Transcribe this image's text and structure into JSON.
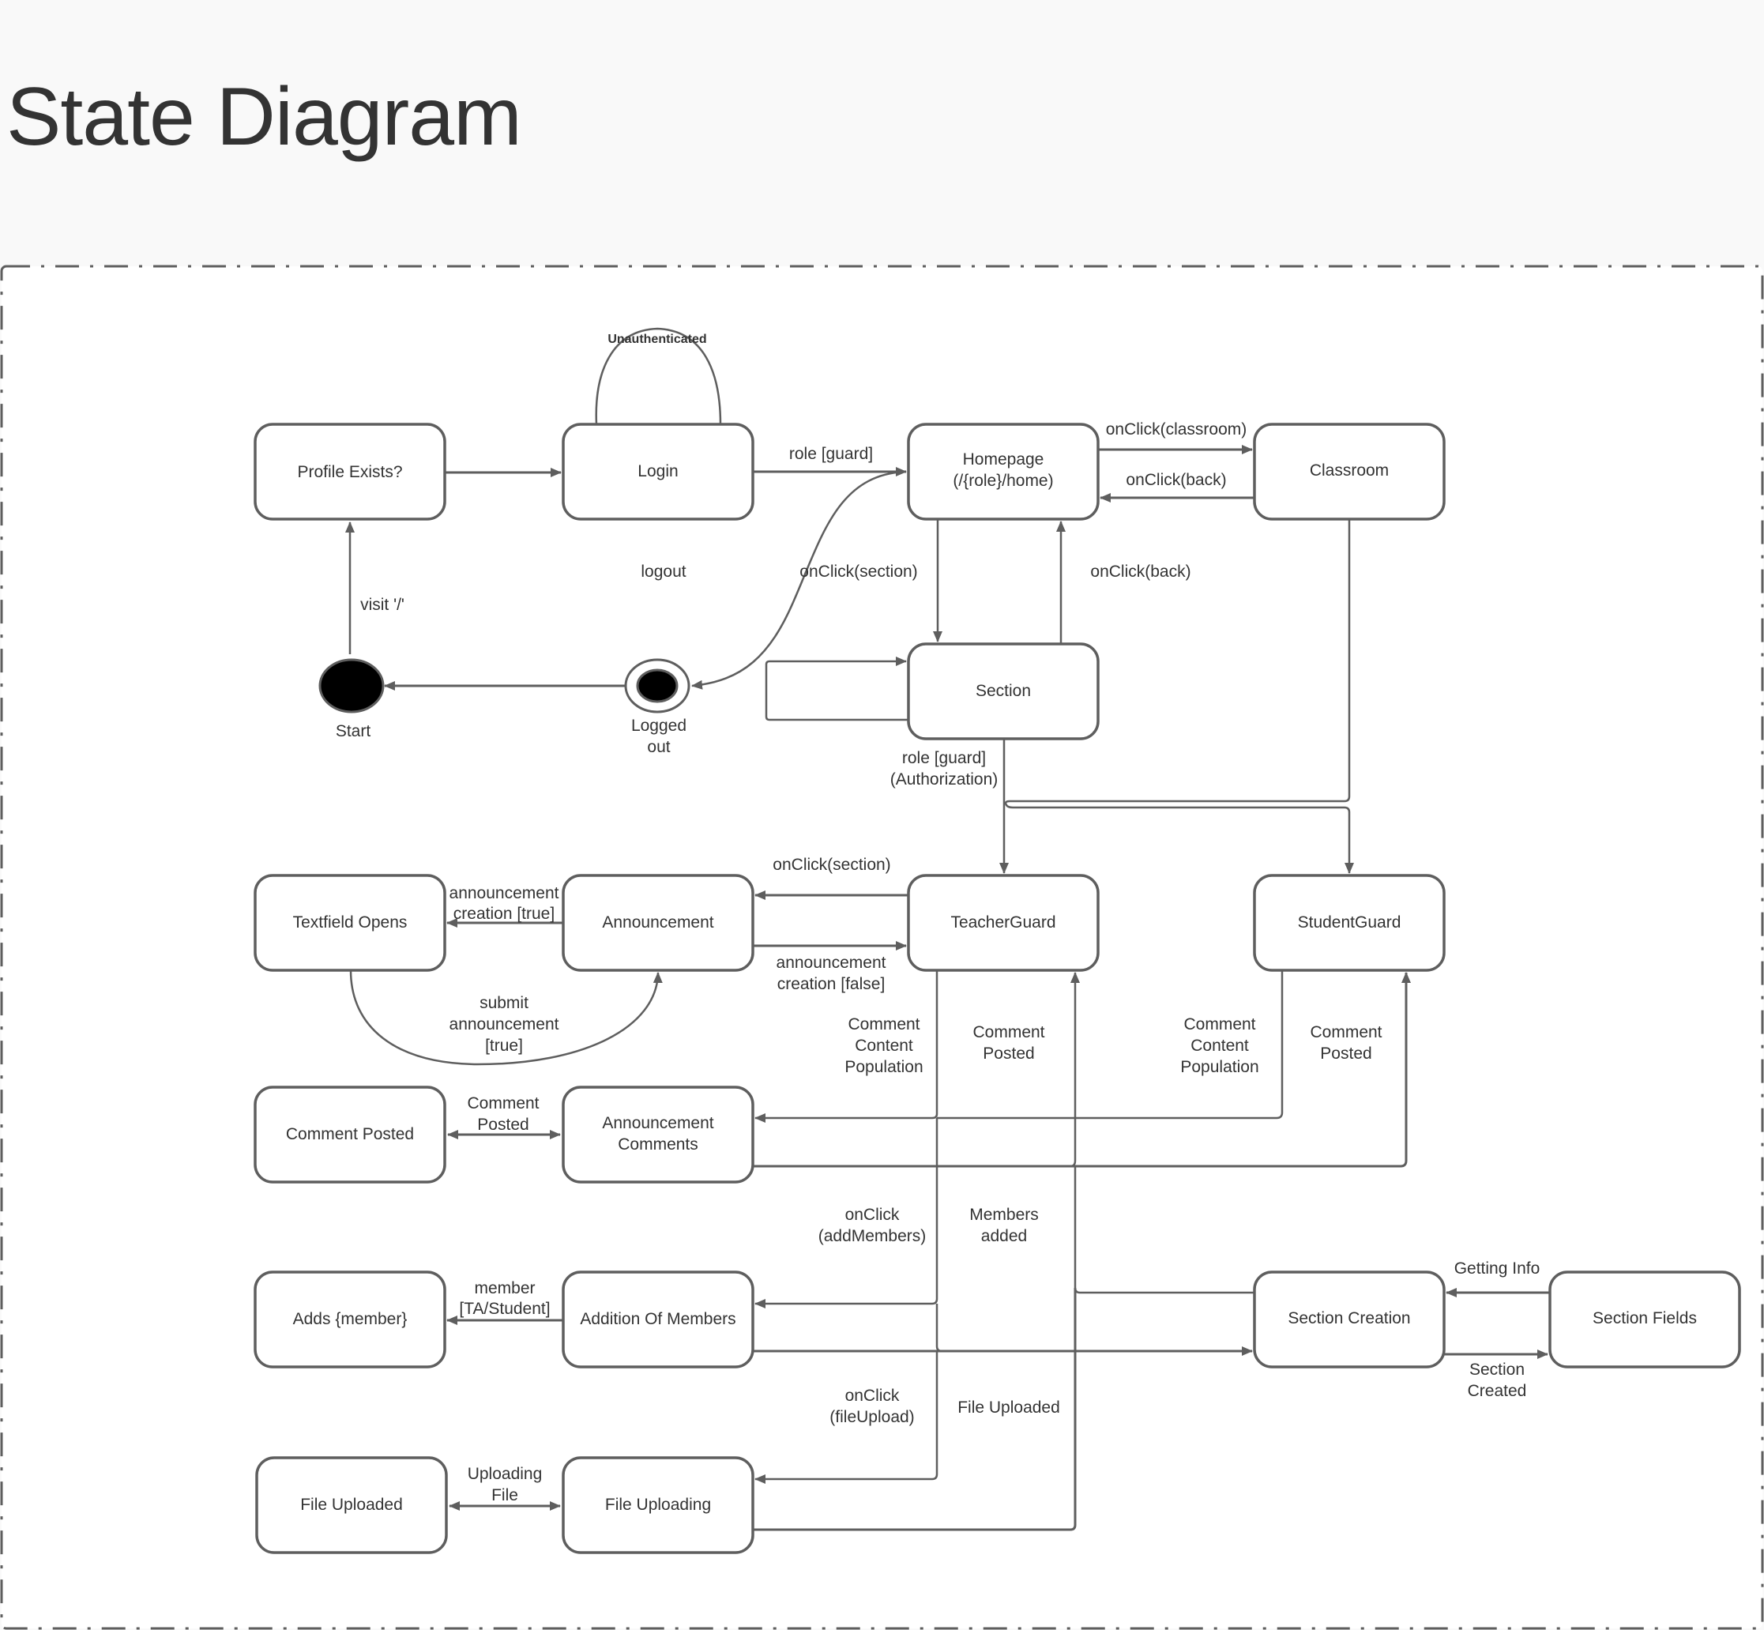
{
  "page": {
    "title": "State Diagram",
    "colors": {
      "background": "#f9f9f9",
      "canvas": "#ffffff",
      "stroke": "#5e5e5e",
      "text": "#333333",
      "pseudo_state_fill": "#000000"
    }
  },
  "diagram": {
    "type": "uml-state-diagram",
    "pseudo_states": {
      "start": {
        "label": "Start",
        "kind": "initial"
      },
      "logged_out": {
        "label_lines": [
          "Logged",
          "out"
        ],
        "kind": "final"
      }
    },
    "states": {
      "profile_exists": {
        "lines": [
          "Profile Exists?"
        ]
      },
      "login": {
        "lines": [
          "Login"
        ]
      },
      "homepage": {
        "lines": [
          "Homepage",
          "(/{role}/home)"
        ]
      },
      "classroom": {
        "lines": [
          "Classroom"
        ]
      },
      "section": {
        "lines": [
          "Section"
        ]
      },
      "textfield_opens": {
        "lines": [
          "Textfield Opens"
        ]
      },
      "announcement": {
        "lines": [
          "Announcement"
        ]
      },
      "teacher_guard": {
        "lines": [
          "TeacherGuard"
        ]
      },
      "student_guard": {
        "lines": [
          "StudentGuard"
        ]
      },
      "comment_posted": {
        "lines": [
          "Comment Posted"
        ]
      },
      "announcement_comments": {
        "lines": [
          "Announcement",
          "Comments"
        ]
      },
      "adds_member": {
        "lines": [
          "Adds {member}"
        ]
      },
      "addition_of_members": {
        "lines": [
          "Addition Of Members"
        ]
      },
      "section_creation": {
        "lines": [
          "Section Creation"
        ]
      },
      "section_fields": {
        "lines": [
          "Section Fields"
        ]
      },
      "file_uploaded": {
        "lines": [
          "File Uploaded"
        ]
      },
      "file_uploading": {
        "lines": [
          "File Uploading"
        ]
      }
    },
    "transitions": {
      "login_self": {
        "from": "Login",
        "to": "Login",
        "lines": [
          "Unauthenticated"
        ]
      },
      "start_to_profile": {
        "from": "Start",
        "to": "Profile Exists?",
        "lines": [
          "visit '/'"
        ]
      },
      "profile_to_login": {
        "from": "Profile Exists?",
        "to": "Login",
        "lines": []
      },
      "login_to_home": {
        "from": "Login",
        "to": "Homepage",
        "lines": [
          "role [guard]"
        ]
      },
      "home_to_logged_out": {
        "from": "Homepage",
        "to": "Logged out",
        "lines": [
          "logout"
        ]
      },
      "logged_out_to_start": {
        "from": "Logged out",
        "to": "Start",
        "lines": []
      },
      "home_to_classroom": {
        "from": "Homepage",
        "to": "Classroom",
        "lines": [
          "onClick(classroom)"
        ]
      },
      "classroom_to_home": {
        "from": "Classroom",
        "to": "Homepage",
        "lines": [
          "onClick(back)"
        ]
      },
      "home_to_section": {
        "from": "Homepage",
        "to": "Section",
        "lines": [
          "onClick(section)"
        ]
      },
      "section_to_home": {
        "from": "Section",
        "to": "Homepage",
        "lines": [
          "onClick(back)"
        ]
      },
      "section_self": {
        "from": "Section",
        "to": "Section",
        "lines": []
      },
      "section_to_guards": {
        "from": "Section",
        "to": "TeacherGuard / StudentGuard",
        "lines": [
          "role [guard]",
          "(Authorization)"
        ]
      },
      "classroom_to_guards": {
        "from": "Classroom",
        "to": "TeacherGuard / StudentGuard",
        "lines": []
      },
      "teacher_to_announcement": {
        "from": "TeacherGuard",
        "to": "Announcement",
        "lines": [
          "onClick(section)"
        ]
      },
      "announcement_to_teacher": {
        "from": "Announcement",
        "to": "TeacherGuard",
        "lines": [
          "announcement",
          "creation [false]"
        ]
      },
      "announcement_to_textfield": {
        "from": "Announcement",
        "to": "Textfield Opens",
        "lines": [
          "announcement",
          "creation [true]"
        ]
      },
      "textfield_to_announcement": {
        "from": "Textfield Opens",
        "to": "Announcement",
        "lines": [
          "submit",
          "announcement",
          "[true]"
        ]
      },
      "teacher_comment_population": {
        "from": "TeacherGuard",
        "to": "Announcement Comments",
        "lines": [
          "Comment",
          "Content",
          "Population"
        ]
      },
      "teacher_comment_posted": {
        "from": "Announcement Comments",
        "to": "TeacherGuard",
        "lines": [
          "Comment",
          "Posted"
        ]
      },
      "student_comment_population": {
        "from": "StudentGuard",
        "to": "Announcement Comments",
        "lines": [
          "Comment",
          "Content",
          "Population"
        ]
      },
      "student_comment_posted": {
        "from": "Announcement Comments",
        "to": "StudentGuard",
        "lines": [
          "Comment",
          "Posted"
        ]
      },
      "comments_to_comment_posted": {
        "from": "Announcement Comments",
        "to": "Comment Posted",
        "lines": [
          "Comment",
          "Posted"
        ],
        "bidirectional": true
      },
      "teacher_to_add_members": {
        "from": "TeacherGuard",
        "to": "Addition Of Members",
        "lines": [
          "onClick",
          "(addMembers)"
        ]
      },
      "add_members_to_section_creation": {
        "from": "Addition Of Members",
        "to": "Section Creation",
        "lines": [
          "Members",
          "added"
        ]
      },
      "add_members_to_adds_member": {
        "from": "Addition Of Members",
        "to": "Adds {member}",
        "lines": [
          "member",
          "[TA/Student]"
        ]
      },
      "section_creation_to_teacher": {
        "from": "Section Creation",
        "to": "TeacherGuard",
        "lines": []
      },
      "section_fields_to_creation": {
        "from": "Section Fields",
        "to": "Section Creation",
        "lines": [
          "Getting Info"
        ]
      },
      "section_creation_to_fields": {
        "from": "Section Creation",
        "to": "Section Fields",
        "lines": [
          "Section",
          "Created"
        ]
      },
      "teacher_to_file_uploading": {
        "from": "TeacherGuard",
        "to": "File Uploading",
        "lines": [
          "onClick",
          "(fileUpload)"
        ]
      },
      "file_uploading_to_teacher": {
        "from": "File Uploading",
        "to": "TeacherGuard",
        "lines": [
          "File Uploaded"
        ]
      },
      "file_uploading_to_uploaded": {
        "from": "File Uploading",
        "to": "File Uploaded",
        "lines": [
          "Uploading",
          "File"
        ],
        "bidirectional": true
      }
    }
  }
}
